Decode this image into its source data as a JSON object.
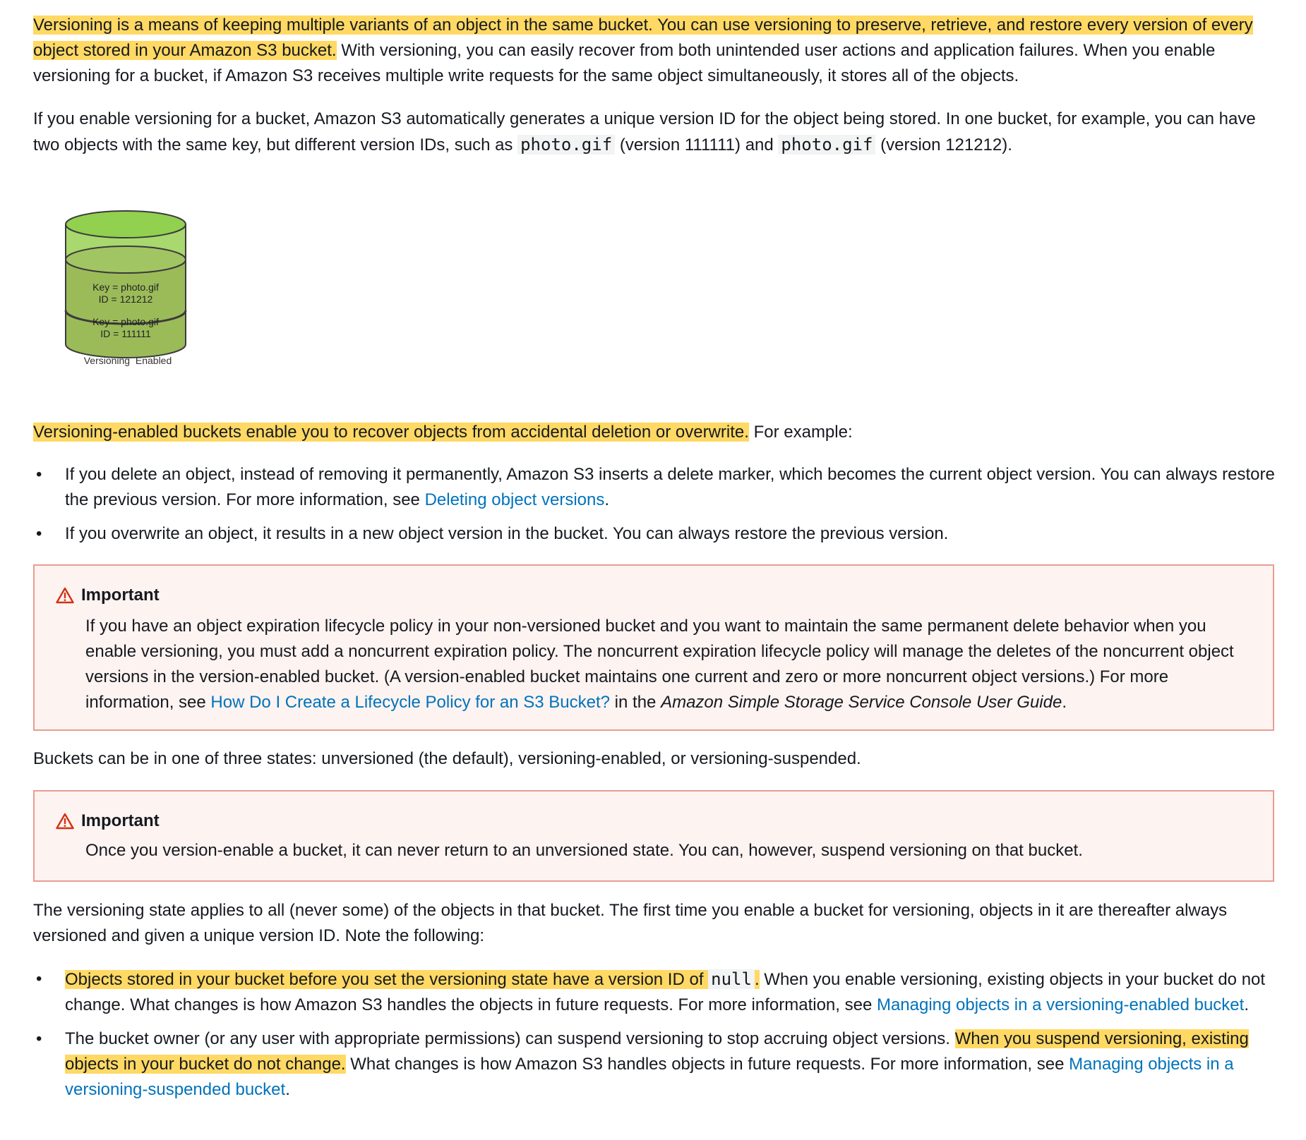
{
  "p1": {
    "highlight": "Versioning is a means of keeping multiple variants of an object in the same bucket. You can use versioning to preserve, retrieve, and restore every version of every object stored in your Amazon S3 bucket.",
    "rest": " With versioning, you can easily recover from both unintended user actions and application failures. When you enable versioning for a bucket, if Amazon S3 receives multiple write requests for the same object simultaneously, it stores all of the objects."
  },
  "p2": {
    "text_a": "If you enable versioning for a bucket, Amazon S3 automatically generates a unique version ID for the object being stored. In one bucket, for example, you can have two objects with the same key, but different version IDs, such as ",
    "code_a": "photo.gif",
    "text_b": " (version 111111) and ",
    "code_b": "photo.gif",
    "text_c": " (version 121212)."
  },
  "figure": {
    "top_label_key": "Key = photo.gif",
    "top_label_id": "ID = 121212",
    "bottom_label_key": "Key = photo.gif",
    "bottom_label_id": "ID = 111111",
    "caption": "Versioning  Enabled",
    "colors": {
      "top": "#92d050",
      "body": "#9bbb59",
      "stroke": "#3b3b3b"
    }
  },
  "p3": {
    "highlight": "Versioning-enabled buckets enable you to recover objects from accidental deletion or overwrite.",
    "rest": " For example:"
  },
  "list1": [
    {
      "text": "If you delete an object, instead of removing it permanently, Amazon S3 inserts a delete marker, which becomes the current object version. You can always restore the previous version. For more information, see ",
      "link": "Deleting object versions",
      "after": "."
    },
    {
      "text": "If you overwrite an object, it results in a new object version in the bucket. You can always restore the previous version."
    }
  ],
  "alert1": {
    "title": "Important",
    "icon": "warning-triangle-icon",
    "text": "If you have an object expiration lifecycle policy in your non-versioned bucket and you want to maintain the same permanent delete behavior when you enable versioning, you must add a noncurrent expiration policy. The noncurrent expiration lifecycle policy will manage the deletes of the noncurrent object versions in the version-enabled bucket. (A version-enabled bucket maintains one current and zero or more noncurrent object versions.) For more information, see ",
    "link": "How Do I Create a Lifecycle Policy for an S3 Bucket?",
    "mid": " in the ",
    "italic": "Amazon Simple Storage Service Console User Guide",
    "after": "."
  },
  "p4": "Buckets can be in one of three states: unversioned (the default), versioning-enabled, or versioning-suspended.",
  "alert2": {
    "title": "Important",
    "icon": "warning-triangle-icon",
    "text": "Once you version-enable a bucket, it can never return to an unversioned state. You can, however, suspend versioning on that bucket."
  },
  "p5": "The versioning state applies to all (never some) of the objects in that bucket. The first time you enable a bucket for versioning, objects in it are thereafter always versioned and given a unique version ID. Note the following:",
  "list2": [
    {
      "highlight_a": "Objects stored in your bucket before you set the versioning state have a version ID of ",
      "code": "null",
      "highlight_b": ".",
      "text": " When you enable versioning, existing objects in your bucket do not change. What changes is how Amazon S3 handles the objects in future requests. For more information, see ",
      "link": "Managing objects in a versioning-enabled bucket",
      "after": "."
    },
    {
      "text": "The bucket owner (or any user with appropriate permissions) can suspend versioning to stop accruing object versions. ",
      "highlight": "When you suspend versioning, existing objects in your bucket do not change.",
      "text_b": " What changes is how Amazon S3 handles objects in future requests. For more information, see ",
      "link": "Managing objects in a versioning-suspended bucket",
      "after": "."
    }
  ],
  "bullet": "•"
}
